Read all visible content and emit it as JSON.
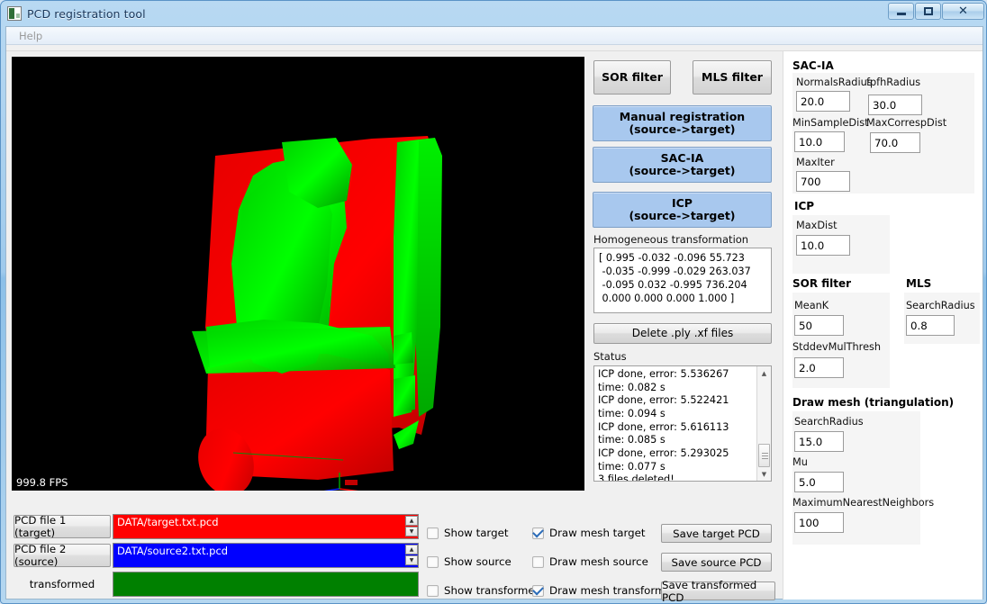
{
  "window": {
    "title": "PCD registration tool",
    "icon": "app-icon",
    "buttons": {
      "minimize": "minimize",
      "maximize": "maximize",
      "close": "close"
    }
  },
  "menubar": {
    "items": [
      {
        "label": "Help"
      }
    ]
  },
  "viewport": {
    "fps": "999.8 FPS",
    "background": "#000000",
    "target_color": "#ff0000",
    "source_color": "#00cc00"
  },
  "actions": {
    "sor_filter": "SOR filter",
    "mls_filter": "MLS filter",
    "manual_registration": "Manual registration\n(source->target)",
    "sac_ia": "SAC-IA\n(source->target)",
    "icp": "ICP\n(source->target)",
    "delete_files": "Delete .ply .xf files"
  },
  "matrix": {
    "label": "Homogeneous transformation matrix",
    "value": "[ 0.995 -0.032 -0.096 55.723\n -0.035 -0.999 -0.029 263.037\n -0.095 0.032 -0.995 736.204\n 0.000 0.000 0.000 1.000 ]"
  },
  "status": {
    "label": "Status",
    "lines": "ICP done, error: 5.536267\ntime: 0.082 s\nICP done, error: 5.522421\ntime: 0.094 s\nICP done, error: 5.616113\ntime: 0.085 s\nICP done, error: 5.293025\ntime: 0.077 s\n3 files deleted!"
  },
  "params": {
    "sac_ia": {
      "title": "SAC-IA",
      "fields": [
        {
          "label": "NormalsRadius",
          "value": "20.0"
        },
        {
          "label": "fpfhRadius",
          "value": "30.0"
        },
        {
          "label": "MinSampleDist",
          "value": "10.0"
        },
        {
          "label": "MaxCorrespDist",
          "value": "70.0"
        },
        {
          "label": "MaxIter",
          "value": "700"
        }
      ]
    },
    "icp": {
      "title": "ICP",
      "fields": [
        {
          "label": "MaxDist",
          "value": "10.0"
        }
      ]
    },
    "sor_filter": {
      "title": "SOR filter",
      "fields": [
        {
          "label": "MeanK",
          "value": "50"
        },
        {
          "label": "StddevMulThresh",
          "value": "2.0"
        }
      ]
    },
    "mls": {
      "title": "MLS",
      "fields": [
        {
          "label": "SearchRadius",
          "value": "0.8"
        }
      ]
    },
    "draw_mesh": {
      "title": "Draw mesh (triangulation)",
      "fields": [
        {
          "label": "SearchRadius",
          "value": "15.0"
        },
        {
          "label": "Mu",
          "value": "5.0"
        },
        {
          "label": "MaximumNearestNeighbors",
          "value": "100"
        }
      ]
    }
  },
  "files": [
    {
      "button": "PCD file 1 (target)",
      "path": "DATA/target.txt.pcd",
      "color": "#ff0000",
      "has_spinner": true
    },
    {
      "button": "PCD file 2 (source)",
      "path": "DATA/source2.txt.pcd",
      "color": "#0000ff",
      "has_spinner": true
    },
    {
      "button": "transformed",
      "path": "",
      "color": "#008000",
      "has_spinner": false
    }
  ],
  "checkboxes": {
    "show": [
      {
        "label": "Show target",
        "checked": false
      },
      {
        "label": "Show source",
        "checked": false
      },
      {
        "label": "Show transformed",
        "checked": false
      }
    ],
    "mesh": [
      {
        "label": "Draw mesh target",
        "checked": true
      },
      {
        "label": "Draw mesh source",
        "checked": false
      },
      {
        "label": "Draw mesh transformed",
        "checked": true
      }
    ]
  },
  "save_buttons": [
    {
      "label": "Save target PCD"
    },
    {
      "label": "Save source PCD"
    },
    {
      "label": "Save transformed PCD"
    }
  ]
}
